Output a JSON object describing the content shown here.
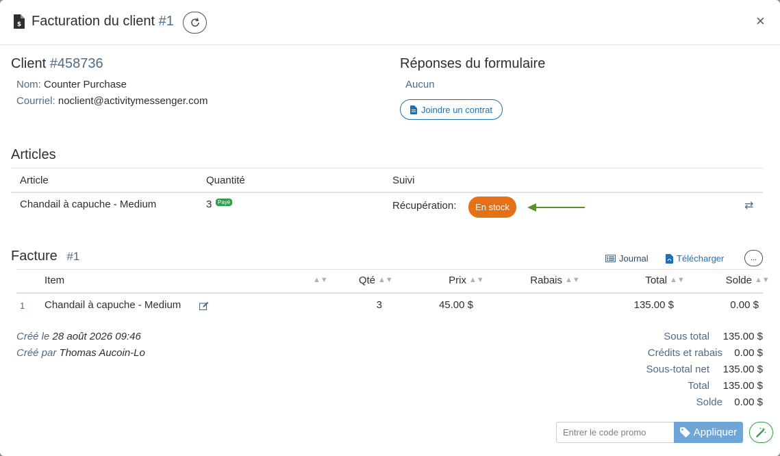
{
  "header": {
    "title": "Facturation du client",
    "number": "#1",
    "close_glyph": "×"
  },
  "client": {
    "title": "Client",
    "id": "#458736",
    "name_label": "Nom:",
    "name_value": "Counter Purchase",
    "email_label": "Courriel:",
    "email_value": "noclient@activitymessenger.com"
  },
  "form": {
    "title": "Réponses du formulaire",
    "value": "Aucun",
    "attach_button": "Joindre un contrat"
  },
  "articles": {
    "title": "Articles",
    "columns": [
      "Article",
      "Quantité",
      "Suivi"
    ],
    "row": {
      "article": "Chandail à capuche - Medium",
      "quantity": "3",
      "paid_badge": "Payé",
      "tracking_label": "Récupération:",
      "status": "En stock"
    }
  },
  "invoice": {
    "title": "Facture",
    "number": "#1",
    "journal_link": "Journal",
    "download_link": "Télécharger",
    "more_button": "...",
    "columns": {
      "item": "Item",
      "qty": "Qté",
      "price": "Prix",
      "discount": "Rabais",
      "total": "Total",
      "balance": "Solde"
    },
    "row": {
      "index": "1",
      "item": "Chandail à capuche - Medium",
      "qty": "3",
      "price": "45.00 $",
      "total": "135.00 $",
      "balance": "0.00 $"
    },
    "created_on_label": "Créé le",
    "created_on_value": "28 août 2026 09:46",
    "created_by_label": "Créé par",
    "created_by_value": "Thomas Aucoin-Lo",
    "totals": [
      {
        "label": "Sous total",
        "value": "135.00 $"
      },
      {
        "label": "Crédits et rabais",
        "value": "0.00 $"
      },
      {
        "label": "Sous-total net",
        "value": "135.00 $"
      },
      {
        "label": "Total",
        "value": "135.00 $"
      },
      {
        "label": "Solde",
        "value": "0.00 $"
      }
    ]
  },
  "promo": {
    "placeholder": "Entrer le code promo",
    "apply_button": "Appliquer"
  },
  "colors": {
    "accent": "#1f6fb5",
    "status_in_stock": "#e67016",
    "paid_green": "#2e9e4a",
    "arrow_green": "#5b8f2e"
  }
}
